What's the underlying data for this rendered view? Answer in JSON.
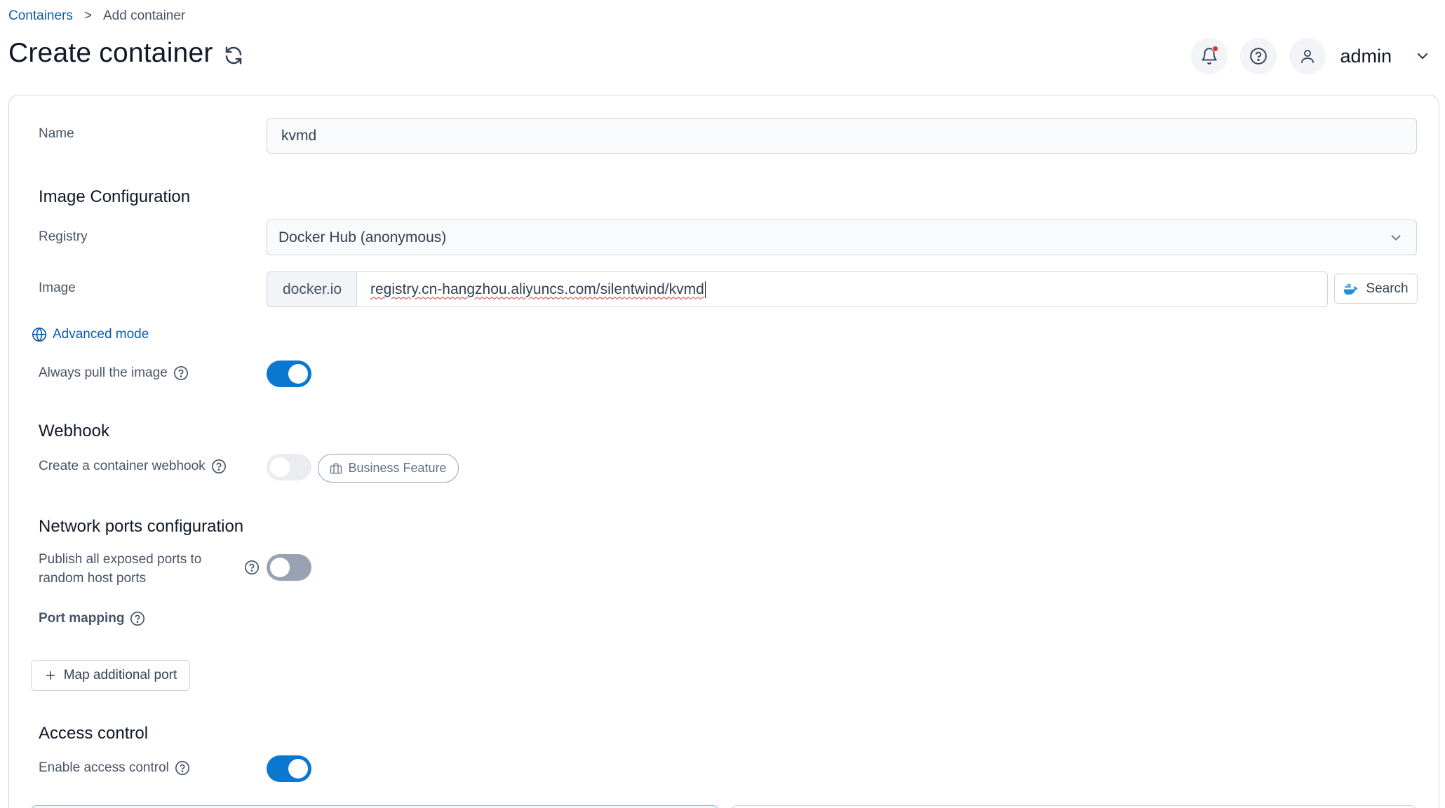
{
  "breadcrumb": {
    "parent": "Containers",
    "separator": ">",
    "current": "Add container"
  },
  "page": {
    "title": "Create container"
  },
  "header": {
    "user": "admin"
  },
  "form": {
    "name": {
      "label": "Name",
      "value": "kvmd"
    },
    "image_config": {
      "title": "Image Configuration",
      "registry_label": "Registry",
      "registry_value": "Docker Hub (anonymous)",
      "image_label": "Image",
      "image_prefix": "docker.io",
      "image_value": "registry.cn-hangzhou.aliyuncs.com/silentwind/kvmd",
      "search_label": "Search",
      "advanced_mode": "Advanced mode",
      "always_pull_label": "Always pull the image",
      "always_pull_on": true
    },
    "webhook": {
      "title": "Webhook",
      "label": "Create a container webhook",
      "enabled": false,
      "badge": "Business Feature"
    },
    "network": {
      "title": "Network ports configuration",
      "publish_label": "Publish all exposed ports to random host ports",
      "publish_on": false,
      "port_mapping_label": "Port mapping",
      "map_button": "Map additional port"
    },
    "access": {
      "title": "Access control",
      "label": "Enable access control",
      "enabled": true
    }
  },
  "colors": {
    "accent": "#0b78d0",
    "link": "#0b5cad",
    "notification": "#e02d2d"
  },
  "icons": [
    "refresh-icon",
    "bell-icon",
    "help-circle-icon",
    "user-icon",
    "chevron-down-icon",
    "globe-icon",
    "docker-icon",
    "briefcase-icon",
    "plus-icon"
  ]
}
